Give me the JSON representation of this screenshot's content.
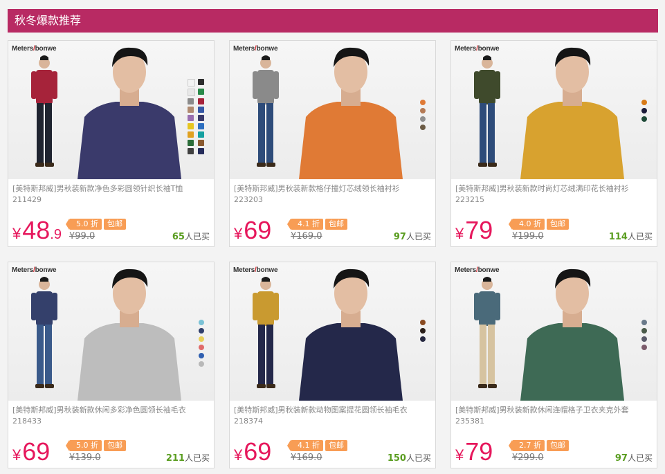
{
  "section": {
    "title": "秋冬爆款推荐"
  },
  "products": [
    {
      "brand_a": "Meters",
      "brand_b": "bonwe",
      "title": "[美特斯邦威]男秋装新款净色多彩圆领针织长袖T恤",
      "code": "211429",
      "currency": "¥",
      "price_int": "48",
      "price_dec": ".9",
      "discount": "5.0 折",
      "shipping": "包邮",
      "original": "¥99.0",
      "sold_count": "65",
      "sold_suffix": "人已买",
      "shirt": "#3a3a6b",
      "full_top": "#a6233a",
      "full_pants": "#1f2430",
      "swatches": [
        "#f3f3f3",
        "#2d2d2d",
        "#e8e8e8",
        "#2a8a4a",
        "#8a8a8a",
        "#a6233a",
        "#b08a70",
        "#3558a6",
        "#9a6fb0",
        "#3a3a6b",
        "#e6c520",
        "#2d6fc0",
        "#e0a020",
        "#15a0a0",
        "#2c6d3a",
        "#8a5a30",
        "#404040",
        "#252c5a"
      ]
    },
    {
      "brand_a": "Meters",
      "brand_b": "bonwe",
      "title": "[美特斯邦威]男秋装新款格仔撞灯芯绒领长袖衬衫",
      "code": "223203",
      "currency": "¥",
      "price_int": "69",
      "price_dec": "",
      "discount": "4.1 折",
      "shipping": "包邮",
      "original": "¥169.0",
      "sold_count": "97",
      "sold_suffix": "人已买",
      "shirt": "#e07a35",
      "full_top": "#8a8a8a",
      "full_pants": "#2e4c7a",
      "swatches": [
        "#e07a35",
        "#b47a55",
        "#8f8f8f",
        "#6b5b45"
      ]
    },
    {
      "brand_a": "Meters",
      "brand_b": "bonwe",
      "title": "[美特斯邦威]男秋装新款时尚灯芯绒满印花长袖衬衫",
      "code": "223215",
      "currency": "¥",
      "price_int": "79",
      "price_dec": "",
      "discount": "4.0 折",
      "shipping": "包邮",
      "original": "¥199.0",
      "sold_count": "114",
      "sold_suffix": "人已买",
      "shirt": "#d8a22f",
      "full_top": "#3f4a2c",
      "full_pants": "#2e4c7a",
      "swatches": [
        "#d87a18",
        "#1c1c3a",
        "#1f4a38"
      ]
    },
    {
      "brand_a": "Meters",
      "brand_b": "bonwe",
      "title": "[美特斯邦威]男秋装新款休闲多彩净色圆领长袖毛衣",
      "code": "218433",
      "currency": "¥",
      "price_int": "69",
      "price_dec": "",
      "discount": "5.0 折",
      "shipping": "包邮",
      "original": "¥139.0",
      "sold_count": "211",
      "sold_suffix": "人已买",
      "shirt": "#bdbdbd",
      "full_top": "#34406b",
      "full_pants": "#3a5a8a",
      "swatches": [
        "#7ac2d6",
        "#2f3e6b",
        "#e8d05a",
        "#e06a6a",
        "#2f5fb0",
        "#b8b8b8"
      ]
    },
    {
      "brand_a": "Meters",
      "brand_b": "bonwe",
      "title": "[美特斯邦威]男秋装新款动物图案提花圆领长袖毛衣",
      "code": "218374",
      "currency": "¥",
      "price_int": "69",
      "price_dec": "",
      "discount": "4.1 折",
      "shipping": "包邮",
      "original": "¥169.0",
      "sold_count": "150",
      "sold_suffix": "人已买",
      "shirt": "#24284a",
      "full_top": "#c99a30",
      "full_pants": "#24284a",
      "swatches": [
        "#8a4a20",
        "#2a1f1a",
        "#262840"
      ]
    },
    {
      "brand_a": "Meters",
      "brand_b": "bonwe",
      "title": "[美特斯邦威]男秋装新款休闲连帽格子卫衣夹克外套",
      "code": "235381",
      "currency": "¥",
      "price_int": "79",
      "price_dec": "",
      "discount": "2.7 折",
      "shipping": "包邮",
      "original": "¥299.0",
      "sold_count": "97",
      "sold_suffix": "人已买",
      "shirt": "#3e6a55",
      "full_top": "#4a6a7a",
      "full_pants": "#d6c3a0",
      "swatches": [
        "#6a7a8a",
        "#4a5a4a",
        "#5a5a6a",
        "#7a5a6a"
      ]
    }
  ]
}
